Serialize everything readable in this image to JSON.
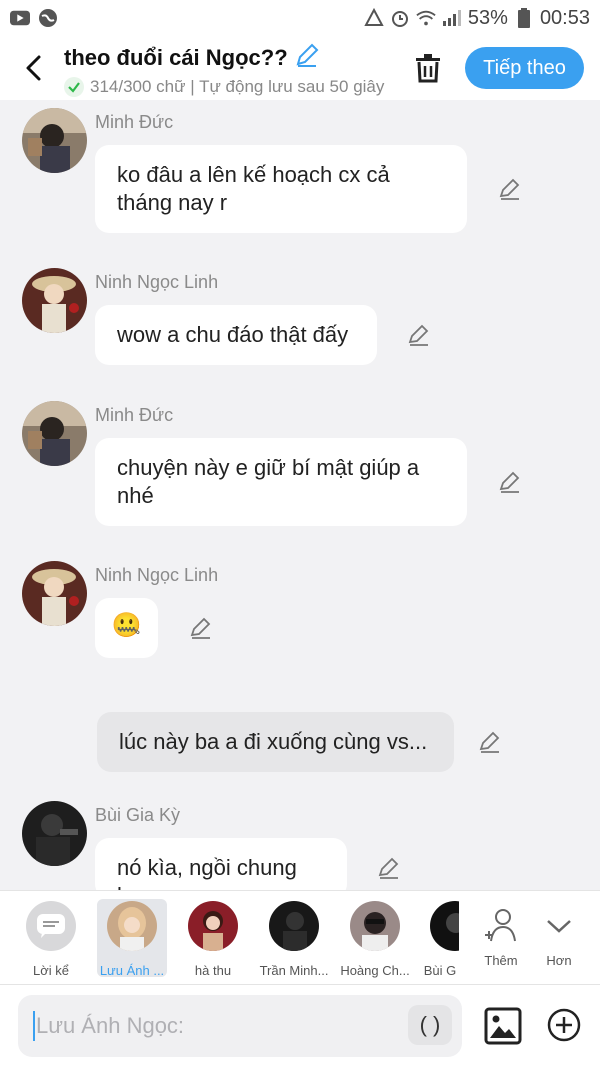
{
  "status_bar": {
    "battery": "53%",
    "time": "00:53",
    "icons": [
      "youtube-icon",
      "globe-icon",
      "recycle-icon",
      "alarm-icon",
      "wifi-icon",
      "signal-icon",
      "battery-icon"
    ]
  },
  "header": {
    "title": "theo đuổi cái Ngọc??",
    "subtitle": "314/300 chữ | Tự động lưu sau 50 giây",
    "next_label": "Tiếp theo"
  },
  "messages": [
    {
      "sender": "Minh Đức",
      "text": "ko đâu a lên kế hoạch cx cả tháng nay r"
    },
    {
      "sender": "Ninh Ngọc Linh",
      "text": "wow a chu đáo thật đấy"
    },
    {
      "sender": "Minh Đức",
      "text": "chuyện này e giữ bí mật giúp a nhé"
    },
    {
      "sender": "Ninh Ngọc Linh",
      "text": "🤐"
    },
    {
      "sender": "",
      "text": "lúc này ba a đi xuống cùng vs..."
    },
    {
      "sender": "Bùi Gia Kỳ",
      "text": "nó kìa, ngồi chung ko"
    }
  ],
  "people": [
    {
      "name": "Lời kể"
    },
    {
      "name": "Lưu Ánh ..."
    },
    {
      "name": "hà thu"
    },
    {
      "name": "Trần Minh..."
    },
    {
      "name": "Hoàng Ch..."
    },
    {
      "name": "Bùi G"
    },
    {
      "name": "Thêm"
    },
    {
      "name": "Hơn"
    }
  ],
  "input": {
    "placeholder": "Lưu Ánh Ngọc:",
    "paren_label": "( )"
  },
  "colors": {
    "accent": "#3aa0f0",
    "background": "#f2f2f4",
    "bubble": "#ffffff",
    "narration_bubble": "#e6e6e8"
  }
}
